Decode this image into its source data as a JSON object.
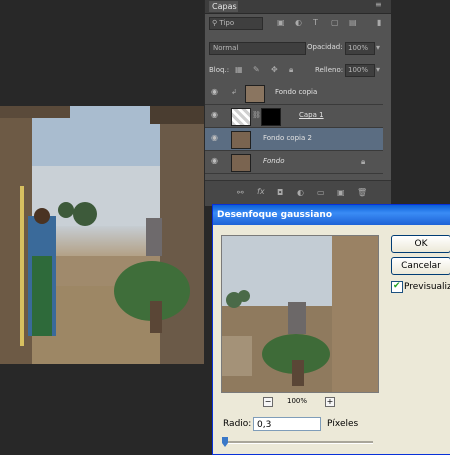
{
  "layers_panel": {
    "tab": "Capas",
    "filter_kind": "Tipo",
    "blend_mode": "Normal",
    "opacity_label": "Opacidad:",
    "opacity_value": "100%",
    "lock_label": "Bloq.:",
    "fill_label": "Relleno:",
    "fill_value": "100%",
    "layers": [
      {
        "name": "Fondo copia",
        "italic": false,
        "selected": false
      },
      {
        "name": "Capa 1",
        "italic": false,
        "selected": false
      },
      {
        "name": "Fondo copia 2",
        "italic": false,
        "selected": true
      },
      {
        "name": "Fondo",
        "italic": true,
        "selected": false
      }
    ]
  },
  "dialog": {
    "title": "Desenfoque gaussiano",
    "ok_label": "OK",
    "cancel_label": "Cancelar",
    "preview_label": "Previsualizar",
    "preview_checked": true,
    "zoom": "100%",
    "zoom_minus": "−",
    "zoom_plus": "+",
    "radius_label": "Radio:",
    "radius_value": "0,3",
    "radius_unit": "Píxeles"
  },
  "colors": {
    "workspace": "#282828",
    "panel_bg": "#535353",
    "selected_layer": "#5b6d82",
    "dialog_bg": "#ece9d8",
    "titlebar": "#0a5fd8"
  }
}
